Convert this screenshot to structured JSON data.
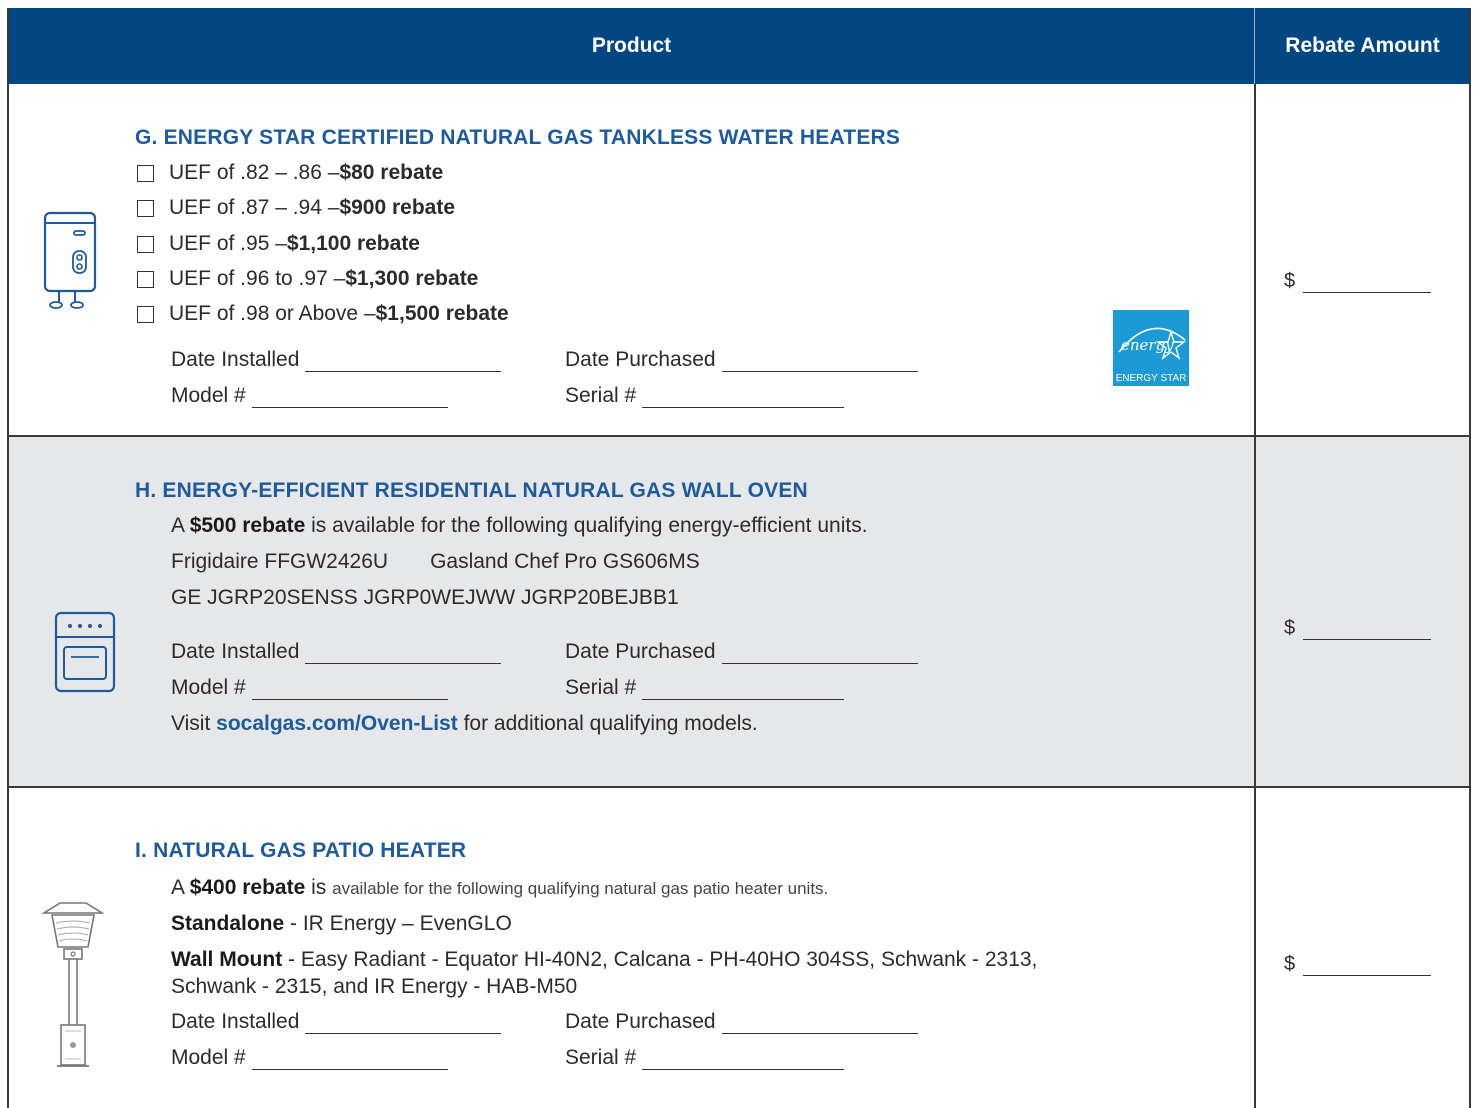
{
  "header": {
    "product": "Product",
    "rebate_amount": "Rebate Amount"
  },
  "section_g": {
    "title": "G. ENERGY STAR CERTIFIED NATURAL GAS TANKLESS WATER HEATERS",
    "options": [
      {
        "text": "UEF of .82 – .86 – ",
        "rebate": "$80 rebate"
      },
      {
        "text": "UEF of .87 – .94  – ",
        "rebate": "$900 rebate"
      },
      {
        "text": "UEF of .95 – ",
        "rebate": "$1,100 rebate"
      },
      {
        "text": "UEF of .96 to .97 – ",
        "rebate": "$1,300 rebate"
      },
      {
        "text": "UEF of .98 or Above – ",
        "rebate": "$1,500 rebate"
      }
    ],
    "date_installed": "Date Installed",
    "date_purchased": "Date Purchased",
    "model": "Model #",
    "serial": "Serial #",
    "logo_text": "ENERGY STAR",
    "amount_prefix": "$"
  },
  "section_h": {
    "title": "H. ENERGY-EFFICIENT RESIDENTIAL NATURAL GAS WALL OVEN",
    "intro_a": "A ",
    "intro_bold": "$500 rebate",
    "intro_rest": " is available for the following qualifying energy-efficient units.",
    "models_line1_a": "Frigidaire FFGW2426U",
    "models_line1_b": "Gasland Chef Pro GS606MS",
    "models_line2": "GE JGRP20SENSS   JGRP0WEJWW  JGRP20BEJBB1",
    "date_installed": "Date Installed",
    "date_purchased": "Date Purchased",
    "model": "Model #",
    "serial": "Serial #",
    "visit_a": "Visit ",
    "visit_link": "socalgas.com/Oven-List",
    "visit_rest": " for additional qualifying models.",
    "amount_prefix": "$"
  },
  "section_i": {
    "title": "I. NATURAL GAS PATIO HEATER",
    "intro_a": "A ",
    "intro_bold": "$400 rebate",
    "intro_is": " is ",
    "intro_rest": "available for the following qualifying natural gas patio heater units.",
    "standalone_label": "Standalone",
    "standalone_text": " - IR Energy – EvenGLO",
    "wall_label": "Wall Mount",
    "wall_text_1": " - Easy Radiant - Equator HI-40N2, Calcana - PH-40HO 304SS, Schwank - 2313,",
    "wall_text_2": "Schwank - 2315, and IR Energy - HAB-M50",
    "date_installed": "Date Installed",
    "date_purchased": "Date Purchased",
    "model": "Model #",
    "serial": "Serial #",
    "amount_prefix": "$"
  }
}
